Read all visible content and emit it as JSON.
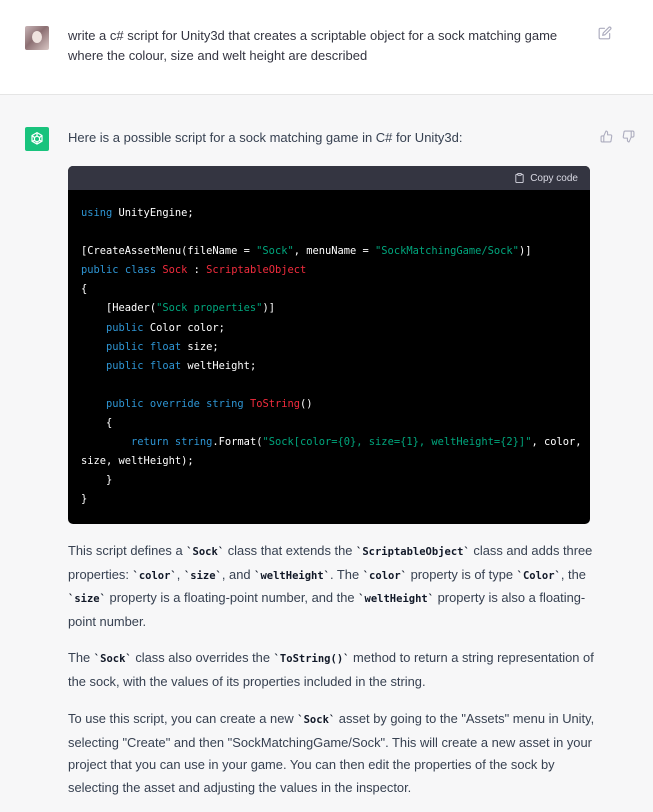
{
  "user_message": {
    "text": "write a c# script for Unity3d that creates a scriptable object for a sock matching game where the colour, size and welt height are described",
    "avatar_icon": "user-avatar",
    "edit_icon": "edit-icon"
  },
  "assistant": {
    "intro": "Here is a possible script for a sock matching game in C# for Unity3d:",
    "code_block": {
      "copy_label": "Copy code",
      "lines": [
        "using UnityEngine;",
        "",
        "[CreateAssetMenu(fileName = \"Sock\", menuName = \"SockMatchingGame/Sock\")]",
        "public class Sock : ScriptableObject",
        "{",
        "    [Header(\"Sock properties\")]",
        "    public Color color;",
        "    public float size;",
        "    public float weltHeight;",
        "",
        "    public override string ToString()",
        "    {",
        "        return string.Format(\"Sock[color={0}, size={1}, weltHeight={2}]\", color,",
        "size, weltHeight);",
        "    }",
        "}"
      ]
    },
    "paragraph1": {
      "t1": "This script defines a ",
      "c1": "`Sock`",
      "t2": " class that extends the ",
      "c2": "`ScriptableObject`",
      "t3": " class and adds three properties: ",
      "c3": "`color`",
      "t4": ", ",
      "c4": "`size`",
      "t5": ", and ",
      "c5": "`weltHeight`",
      "t6": ". The ",
      "c6": "`color`",
      "t7": " property is of type ",
      "c7": "`Color`",
      "t8": ", the ",
      "c8": "`size`",
      "t9": " property is a floating-point number, and the ",
      "c9": "`weltHeight`",
      "t10": " property is also a floating-point number."
    },
    "paragraph2": {
      "t1": "The ",
      "c1": "`Sock`",
      "t2": " class also overrides the ",
      "c2": "`ToString()`",
      "t3": " method to return a string representation of the sock, with the values of its properties included in the string."
    },
    "paragraph3": {
      "t1": "To use this script, you can create a new ",
      "c1": "`Sock`",
      "t2": " asset by going to the \"Assets\" menu in Unity, selecting \"Create\" and then \"SockMatchingGame/Sock\". This will create a new asset in your project that you can use in your game. You can then edit the properties of the sock by selecting the asset and adjusting the values in the inspector."
    }
  },
  "colors": {
    "assistant_avatar": "#19c37d",
    "code_background": "#000000",
    "code_header": "#343541",
    "keyword": "#2e95d3",
    "type": "#f22c3d",
    "string": "#00a67d"
  }
}
